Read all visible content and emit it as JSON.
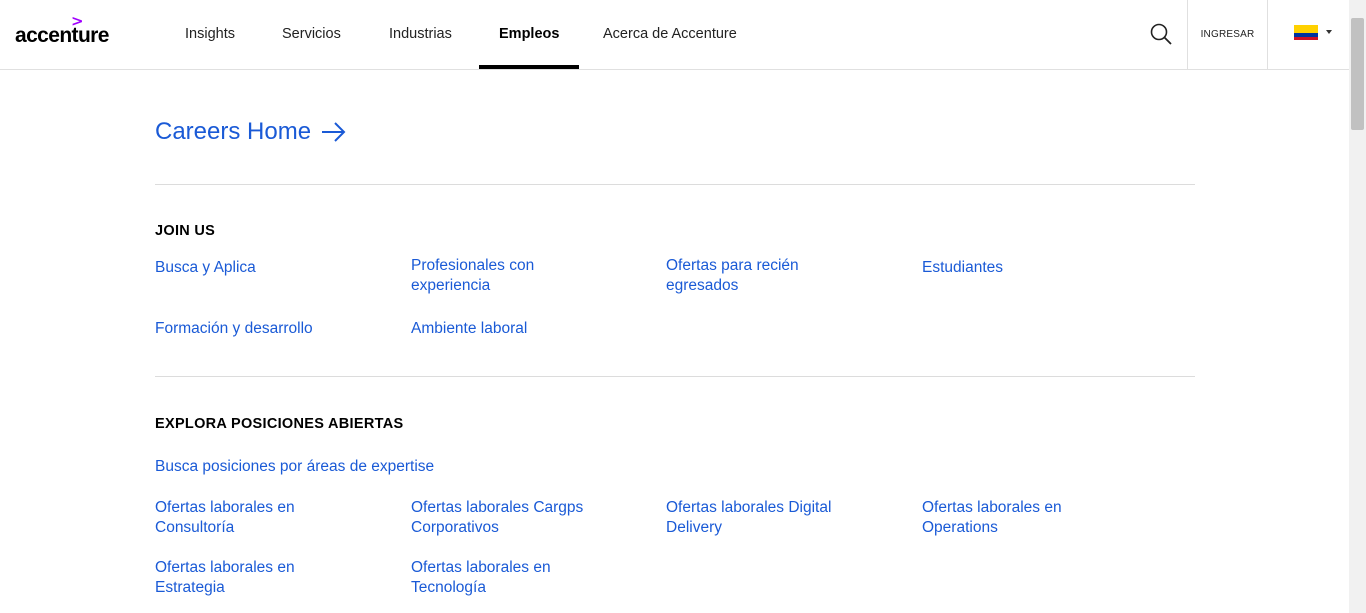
{
  "header": {
    "logo_mark": ">",
    "logo_text": "accenture",
    "nav": [
      "Insights",
      "Servicios",
      "Industrias",
      "Empleos",
      "Acerca de Accenture"
    ],
    "active_nav": "Empleos",
    "signin_label": "INGRESAR",
    "country_flag": "colombia-flag",
    "colors": {
      "logo_accent": "#a100ff"
    }
  },
  "main": {
    "careers_home_label": "Careers Home",
    "join_us": {
      "title": "JOIN US",
      "links": [
        "Busca y Aplica",
        "Profesionales con experiencia",
        "Ofertas para recién egresados",
        "Estudiantes",
        "Formación y desarrollo",
        "Ambiente laboral"
      ]
    },
    "explore": {
      "title": "EXPLORA POSICIONES ABIERTAS",
      "expertise_link": "Busca posiciones por áreas de expertise",
      "links": [
        "Ofertas laborales en Consultoría",
        "Ofertas laborales Cargps Corporativos",
        "Ofertas laborales Digital Delivery",
        "Ofertas laborales en Operations",
        "Ofertas laborales en Estrategia",
        "Ofertas laborales en Tecnología"
      ]
    },
    "colors": {
      "link": "#1a5ad6"
    }
  }
}
